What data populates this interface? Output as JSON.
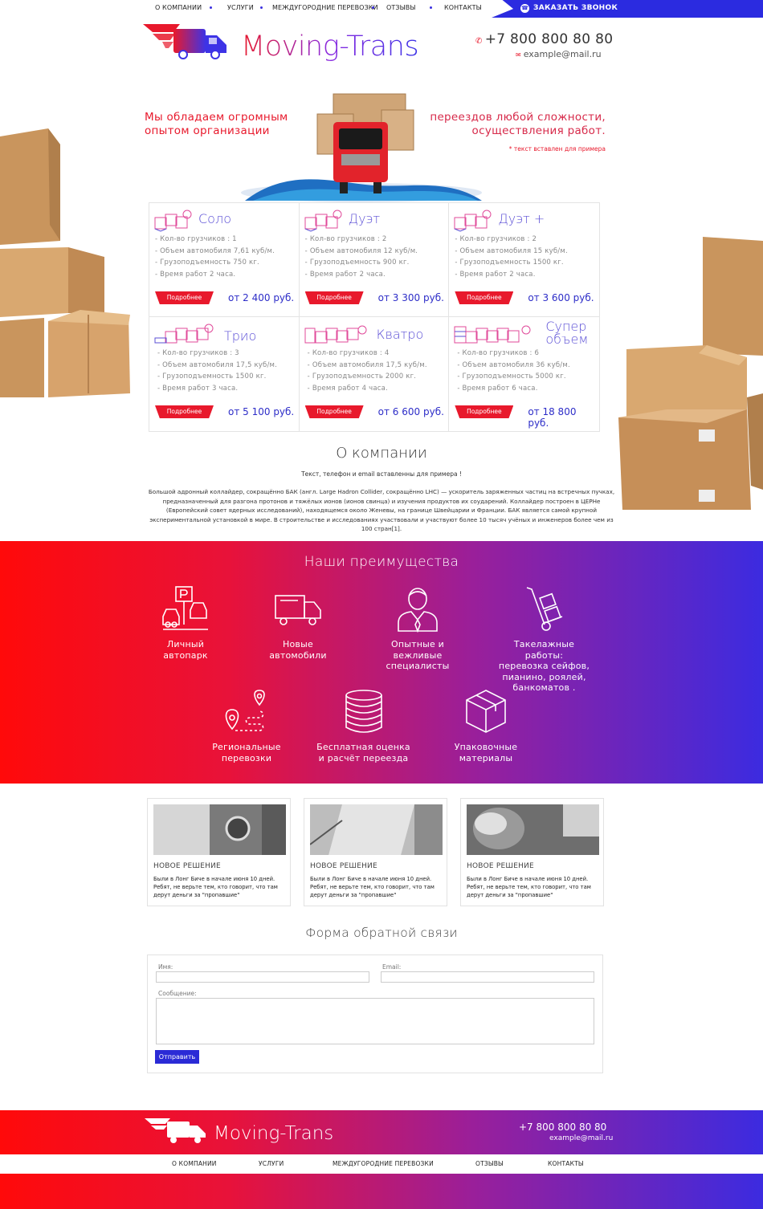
{
  "nav": {
    "items": [
      "О КОМПАНИИ",
      "УСЛУГИ",
      "МЕЖДУГОРОДНИЕ ПЕРЕВОЗКИ",
      "ОТЗЫВЫ",
      "КОНТАКТЫ"
    ],
    "call_button": "ЗАКАЗАТЬ ЗВОНОК"
  },
  "header": {
    "brand": "Moving-Trans",
    "phone": "+7 800 800 80 80",
    "email": "example@mail.ru"
  },
  "hero": {
    "left_text_line1": "Мы обладаем огромным",
    "left_text_line2": "опытом организации",
    "right_text_line1": "переездов любой сложности,",
    "right_text_line2": "осуществления работ.",
    "note": "* текст вставлен для примера"
  },
  "tariffs": [
    {
      "name": "Соло",
      "specs": [
        "- Кол-во грузчиков : 1",
        "- Объем автомобиля 7,61 куб/м.",
        "- Грузоподъемность 750 кг.",
        "- Время работ 2 часа."
      ],
      "more": "Подробнее",
      "price": "от 2 400 руб."
    },
    {
      "name": "Дуэт",
      "specs": [
        "- Кол-во грузчиков : 2",
        "- Объем автомобиля 12 куб/м.",
        "- Грузоподъемность 900 кг.",
        "- Время работ 2 часа."
      ],
      "more": "Подробнее",
      "price": "от 3 300 руб."
    },
    {
      "name": "Дуэт +",
      "specs": [
        "- Кол-во грузчиков : 2",
        "- Объем автомобиля 15 куб/м.",
        "- Грузоподъемность 1500 кг.",
        "- Время работ 2 часа."
      ],
      "more": "Подробнее",
      "price": "от 3 600 руб."
    },
    {
      "name": "Трио",
      "specs": [
        "- Кол-во грузчиков : 3",
        "- Объем автомобиля 17,5 куб/м.",
        "- Грузоподъемность 1500 кг.",
        "- Время работ 3 часа."
      ],
      "more": "Подробнее",
      "price": "от 5 100 руб."
    },
    {
      "name": "Кватро",
      "specs": [
        "- Кол-во грузчиков : 4",
        "- Объем автомобиля 17,5 куб/м.",
        "- Грузоподъемность 2000 кг.",
        "- Время работ 4 часа."
      ],
      "more": "Подробнее",
      "price": "от 6 600 руб."
    },
    {
      "name": "Супер объем",
      "specs": [
        "- Кол-во грузчиков : 6",
        "- Объем автомобиля 36 куб/м.",
        "- Грузоподъемность 5000 кг.",
        "- Время работ 6 часа."
      ],
      "more": "Подробнее",
      "price": "от 18 800 руб."
    }
  ],
  "about": {
    "title": "О компании",
    "subtitle": "Текст, телефон и email вставленны для примера !",
    "text": "Большой адронный коллайдер, сокращённо БАК (англ. Large Hadron Collider, сокращённо LHC) — ускоритель заряженных частиц на встречных пучках, предназначенный для разгона протонов и тяжёлых ионов (ионов свинца) и изучения продуктов их соударений. Коллайдер построен в ЦЕРНе (Европейский совет ядерных исследований), находящемся около Женевы, на границе Швейцарии и Франции. БАК является самой крупной экспериментальной установкой в мире. В строительстве и исследованиях участвовали и участвуют более 10 тысяч учёных и инженеров более чем из 100 стран[1]."
  },
  "advantages": {
    "title": "Наши преимущества",
    "items": [
      {
        "icon": "parking-icon",
        "line1": "Личный",
        "line2": "автопарк",
        "line3": "",
        "line4": ""
      },
      {
        "icon": "truck-icon",
        "line1": "Новые",
        "line2": "автомобили",
        "line3": "",
        "line4": ""
      },
      {
        "icon": "specialist-icon",
        "line1": "Опытные и",
        "line2": "вежливые",
        "line3": "специалисты",
        "line4": ""
      },
      {
        "icon": "hand-truck-icon",
        "line1": "Такелажные работы:",
        "line2": "перевозка сейфов,",
        "line3": "пианино, роялей,",
        "line4": "банкоматов ."
      },
      {
        "icon": "route-icon",
        "line1": "Региональные",
        "line2": "перевозки",
        "line3": "",
        "line4": ""
      },
      {
        "icon": "coins-icon",
        "line1": "Бесплатная оценка",
        "line2": "и расчёт переезда",
        "line3": "",
        "line4": ""
      },
      {
        "icon": "box-icon",
        "line1": "Упаковочные",
        "line2": "материалы",
        "line3": "",
        "line4": ""
      }
    ]
  },
  "news": [
    {
      "title": "НОВОЕ РЕШЕНИЕ",
      "text": "Были в Лонг Биче в начале июня 10 дней. Ребят, не верьте тем, кто говорит, что там дерут деньги за \"пропавшие\""
    },
    {
      "title": "НОВОЕ РЕШЕНИЕ",
      "text": "Были в Лонг Биче в начале июня 10 дней. Ребят, не верьте тем, кто говорит, что там дерут деньги за \"пропавшие\""
    },
    {
      "title": "НОВОЕ РЕШЕНИЕ",
      "text": "Были в Лонг Биче в начале июня 10 дней. Ребят, не верьте тем, кто говорит, что там дерут деньги за \"пропавшие\""
    }
  ],
  "form": {
    "title": "Форма обратной связи",
    "name_label": "Имя:",
    "email_label": "Email:",
    "message_label": "Сообщение:",
    "submit": "Отправить"
  },
  "footer": {
    "brand": "Moving-Trans",
    "phone": "+7 800 800 80 80",
    "email": "example@mail.ru",
    "nav": [
      "О КОМПАНИИ",
      "УСЛУГИ",
      "МЕЖДУГОРОДНИЕ ПЕРЕВОЗКИ",
      "ОТЗЫВЫ",
      "КОНТАКТЫ"
    ]
  },
  "colors": {
    "accent_red": "#e8192c",
    "accent_blue": "#2b2be0",
    "accent_violet": "#5b4fd6"
  }
}
